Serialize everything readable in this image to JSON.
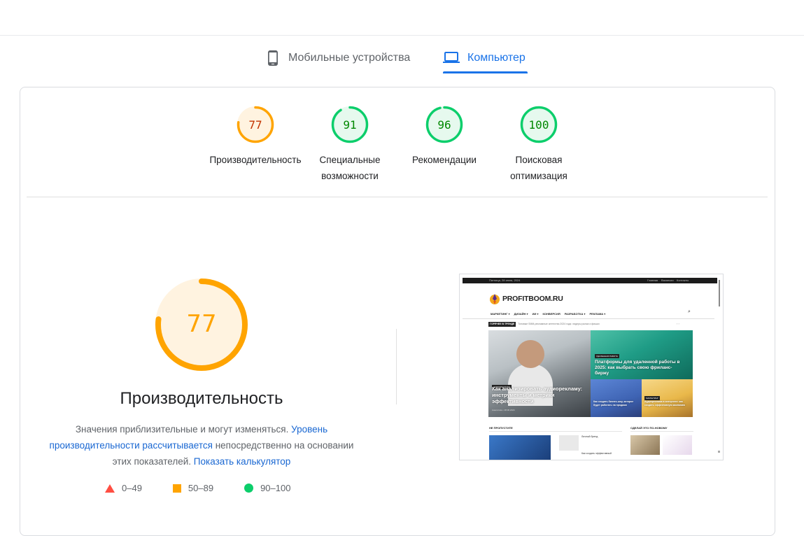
{
  "tabs": [
    {
      "label": "Мобильные устройства",
      "icon": "smartphone-icon",
      "active": false
    },
    {
      "label": "Компьютер",
      "icon": "desktop-icon",
      "active": true
    }
  ],
  "colors": {
    "pass": "#0cce6b",
    "average": "#ffa400",
    "fail": "#ff4e42",
    "accent": "#1a73e8"
  },
  "scores": [
    {
      "value": "77",
      "label": "Производительность",
      "level": "average"
    },
    {
      "value": "91",
      "label": "Специальные возможности",
      "level": "pass"
    },
    {
      "value": "96",
      "label": "Рекомендации",
      "level": "pass"
    },
    {
      "value": "100",
      "label": "Поисковая оптимизация",
      "level": "pass"
    }
  ],
  "performance": {
    "score": "77",
    "title": "Производительность",
    "desc_text_1": "Значения приблизительные и могут изменяться. ",
    "desc_link_1": "Уровень производительности рассчитывается",
    "desc_text_2": " непосредственно на основании этих показателей. ",
    "desc_link_2": "Показать калькулятор"
  },
  "legend": [
    {
      "range": "0–49",
      "shape": "triangle",
      "level": "fail"
    },
    {
      "range": "50–89",
      "shape": "square",
      "level": "average"
    },
    {
      "range": "90–100",
      "shape": "circle",
      "level": "pass"
    }
  ],
  "screenshot": {
    "topbar_date": "Пятница, 28 июня, 2024",
    "topbar_links": [
      "Главная",
      "Вакансии",
      "Контакты"
    ],
    "site_name": "PROFITBOOM.RU",
    "menu": [
      "МАРКЕТИНГ ▾",
      "ДИЗАЙН ▾",
      "ИИ ▾",
      "КОНВЕРСИЯ",
      "РАЗРАБОТКА ▾",
      "РЕКЛАМА ▾"
    ],
    "ticker_label": "ГОРЯЧЕЕ В ТРЕНДЕ",
    "ticker_text": "Топовые SMM-рекламные агентства 2024 года: лидеры рынка и фишки",
    "featured_tag": "АУДИОРЕКЛАМА",
    "featured_title": "Как анализировать аудиорекламу: инструменты и метрики эффективности",
    "featured_meta": "Аналитика • 28.06.2024",
    "card2_tag": "УДАЛЕННАЯ РАБОТА",
    "card2_title": "Платформы для удаленной работы в 2025: как выбрать свою фриланс-биржу",
    "card3_title": "Как создать бизнес-шоу, которое будет работать на продажи",
    "card4_tag": "МАРКЕТИНГ",
    "card4_title": "Аудиореклама в интернете: как создать эффективную кампанию",
    "section1": "НЕ ПРОПУСТИТЕ",
    "section2": "СДЕЛАЙ ЭТО ПО-НОВОМУ",
    "small1": "Личный бренд",
    "small2": "Как создать эффективный"
  }
}
